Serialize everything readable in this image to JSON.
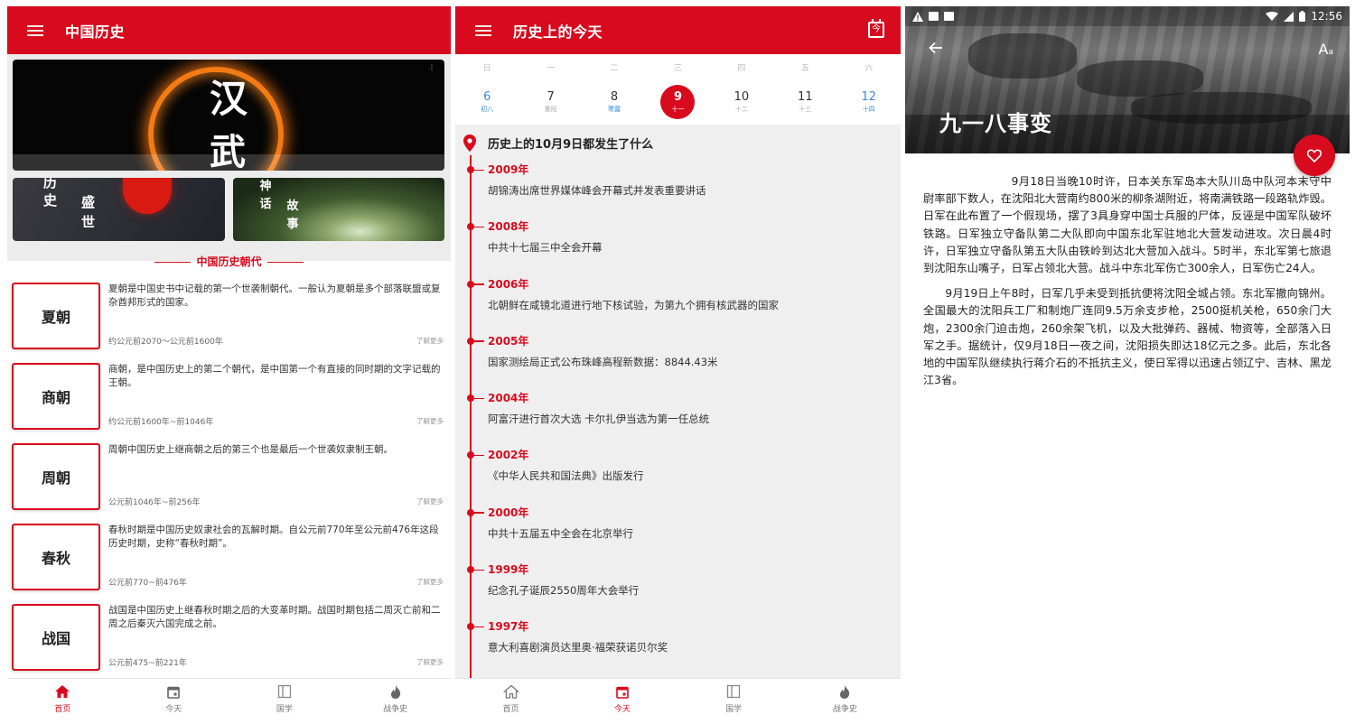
{
  "home": {
    "title": "中国历史",
    "banner": {
      "main_chars": [
        "汉",
        "武"
      ],
      "left_chars": [
        "历",
        "史",
        "盛",
        "世"
      ],
      "right_chars": [
        "神",
        "话",
        "故",
        "事"
      ]
    },
    "section_title": "中国历史朝代",
    "more_label": "了解更多",
    "dynasties": [
      {
        "name": "夏朝",
        "desc": "夏朝是中国史书中记载的第一个世袭制朝代。一般认为夏朝是多个部落联盟或复杂酋邦形式的国家。",
        "period": "约公元前2070～公元前1600年"
      },
      {
        "name": "商朝",
        "desc": "商朝，是中国历史上的第二个朝代，是中国第一个有直接的同时期的文字记载的王朝。",
        "period": "约公元前1600年~前1046年"
      },
      {
        "name": "周朝",
        "desc": "周朝中国历史上继商朝之后的第三个也是最后一个世袭奴隶制王朝。",
        "period": "公元前1046年~前256年"
      },
      {
        "name": "春秋",
        "desc": "春秋时期是中国历史奴隶社会的瓦解时期。自公元前770年至公元前476年这段历史时期，史称“春秋时期”。",
        "period": "公元前770~前476年"
      },
      {
        "name": "战国",
        "desc": "战国是中国历史上继春秋时期之后的大变革时期。战国时期包括二周灭亡前和二周之后秦灭六国完成之前。",
        "period": "公元前475~前221年"
      }
    ]
  },
  "nav": {
    "items": [
      "首页",
      "今天",
      "国学",
      "战争史"
    ]
  },
  "today": {
    "title": "历史上的今天",
    "calendar_btn": "今",
    "week_head": [
      "日",
      "一",
      "二",
      "三",
      "四",
      "五",
      "六"
    ],
    "days": [
      {
        "num": "6",
        "sub": "初八"
      },
      {
        "num": "7",
        "sub": "重阳"
      },
      {
        "num": "8",
        "sub": "寒露"
      },
      {
        "num": "9",
        "sub": "十一"
      },
      {
        "num": "10",
        "sub": "十二"
      },
      {
        "num": "11",
        "sub": "十三"
      },
      {
        "num": "12",
        "sub": "十四"
      }
    ],
    "heading": "历史上的10月9日都发生了什么",
    "events": [
      {
        "year": "2009年",
        "text": "胡锦涛出席世界媒体峰会开幕式并发表重要讲话"
      },
      {
        "year": "2008年",
        "text": "中共十七届三中全会开幕"
      },
      {
        "year": "2006年",
        "text": "北朝鲜在咸镜北道进行地下核试验，为第九个拥有核武器的国家"
      },
      {
        "year": "2005年",
        "text": "国家测绘局正式公布珠峰高程新数据：8844.43米"
      },
      {
        "year": "2004年",
        "text": "阿富汗进行首次大选 卡尔扎伊当选为第一任总统"
      },
      {
        "year": "2002年",
        "text": "《中华人民共和国法典》出版发行"
      },
      {
        "year": "2000年",
        "text": "中共十五届五中全会在北京举行"
      },
      {
        "year": "1999年",
        "text": "纪念孔子诞辰2550周年大会举行"
      },
      {
        "year": "1997年",
        "text": "意大利喜剧演员达里奥·福荣获诺贝尔奖"
      }
    ]
  },
  "article": {
    "status_time": "12:56",
    "font_btn": "A",
    "font_btn_small": "a",
    "title": "九一八事变",
    "paragraphs": [
      "9月18日当晚10时许，日本关东军岛本大队川岛中队河本末守中尉率部下数人，在沈阳北大营南约800米的柳条湖附近，将南满铁路一段路轨炸毁。日军在此布置了一个假现场，摆了3具身穿中国士兵服的尸体，反诬是中国军队破坏铁路。日军独立守备队第二大队即向中国东北军驻地北大营发动进攻。次日晨4时许，日军独立守备队第五大队由铁岭到达北大营加入战斗。5时半，东北军第七旅退到沈阳东山嘴子，日军占领北大营。战斗中东北军伤亡300余人，日军伤亡24人。",
      "9月19日上午8时，日军几乎未受到抵抗便将沈阳全城占领。东北军撤向锦州。全国最大的沈阳兵工厂和制炮厂连同9.5万余支步枪，2500挺机关枪，650余门大炮，2300余门迫击炮，260余架飞机，以及大批弹药、器械、物资等，全部落入日军之手。据统计，仅9月18日一夜之间，沈阳损失即达18亿元之多。此后，东北各地的中国军队继续执行蒋介石的不抵抗主义，使日军得以迅速占领辽宁、吉林、黑龙江3省。"
    ]
  },
  "colors": {
    "primary": "#d80b1e",
    "accent_blue": "#3a8bd5"
  }
}
